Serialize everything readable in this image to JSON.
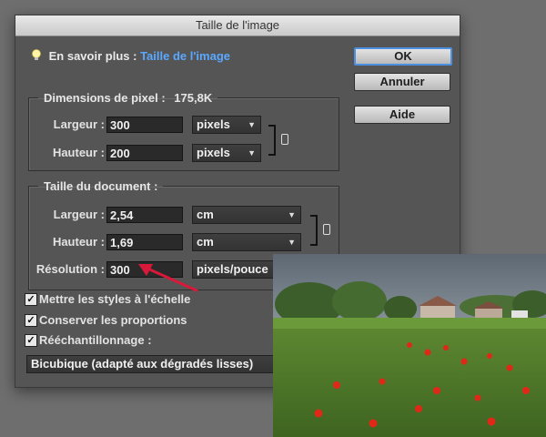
{
  "dialog": {
    "title": "Taille de l'image",
    "info_prefix": "En savoir plus :",
    "info_link": "Taille de l'image",
    "buttons": {
      "ok": "OK",
      "cancel": "Annuler",
      "help": "Aide"
    }
  },
  "pixel_dimensions": {
    "title": "Dimensions de pixel :",
    "size": "175,8K",
    "width_label": "Largeur :",
    "width_value": "300",
    "width_unit": "pixels",
    "height_label": "Hauteur :",
    "height_value": "200",
    "height_unit": "pixels"
  },
  "document_size": {
    "title": "Taille du document :",
    "width_label": "Largeur :",
    "width_value": "2,54",
    "width_unit": "cm",
    "height_label": "Hauteur :",
    "height_value": "1,69",
    "height_unit": "cm",
    "resolution_label": "Résolution :",
    "resolution_value": "300",
    "resolution_unit": "pixels/pouce"
  },
  "options": {
    "scale_styles": "Mettre les styles à l'échelle",
    "constrain": "Conserver les proportions",
    "resample": "Rééchantillonnage :",
    "method": "Bicubique (adapté aux dégradés lisses)",
    "scale_styles_checked": true,
    "constrain_checked": true,
    "resample_checked": true
  },
  "icons": {
    "bulb": "lightbulb-icon",
    "link": "chain-link-icon",
    "dropdown": "caret-down-icon",
    "check": "checkmark-icon"
  },
  "colors": {
    "link": "#5aa8ff",
    "dialog_bg": "#555555",
    "arrow": "#d8193a"
  }
}
